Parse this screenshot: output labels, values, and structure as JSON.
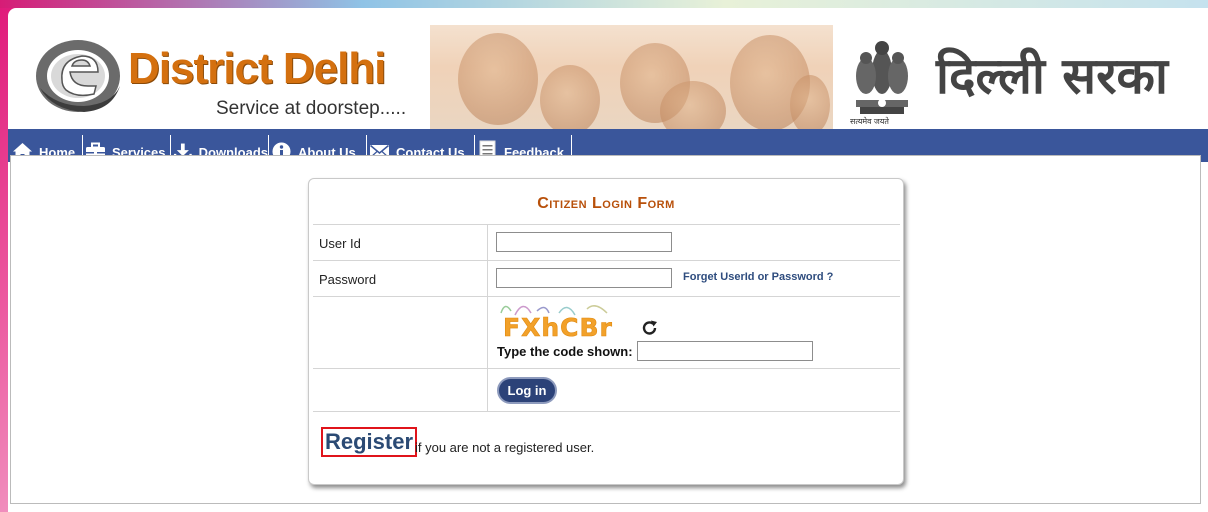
{
  "brand": {
    "logo_title": "District Delhi",
    "tagline": "Service at doorstep.....",
    "gov_title_hindi": "दिल्ली सरका",
    "emblem_motto": "सत्यमेव जयते"
  },
  "nav": {
    "items": [
      {
        "label": "Home",
        "icon": "home-icon"
      },
      {
        "label": "Services",
        "icon": "briefcase-icon"
      },
      {
        "label": "Downloads",
        "icon": "download-icon"
      },
      {
        "label": "About Us",
        "icon": "info-icon"
      },
      {
        "label": "Contact Us",
        "icon": "mail-icon"
      },
      {
        "label": "Feedback",
        "icon": "document-icon"
      }
    ]
  },
  "form": {
    "title": "Citizen Login Form",
    "userid_label": "User Id",
    "userid_value": "",
    "password_label": "Password",
    "password_value": "",
    "forgot_link": "Forget UserId or Password ?",
    "captcha_text": "FXhCBr",
    "code_label": "Type the code shown:",
    "code_value": "",
    "login_button": "Log in",
    "register_link": "Register",
    "register_note": "if you are not a registered user."
  },
  "colors": {
    "nav_bg": "#3a569b",
    "title_orange": "#b8500a",
    "logo_orange": "#d4700f",
    "button_blue": "#2c4278",
    "highlight_red": "#e0141b"
  }
}
